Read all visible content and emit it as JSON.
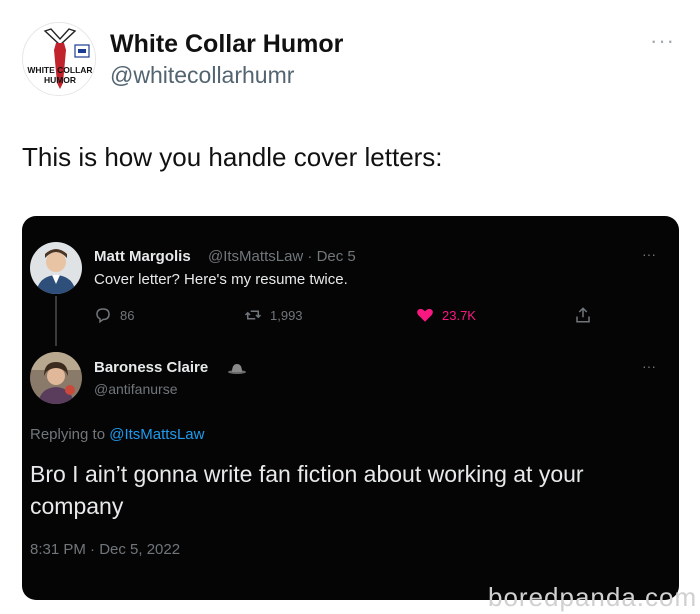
{
  "post": {
    "author_name": "White Collar Humor",
    "author_handle": "@whitecollarhumr",
    "more_label": "···",
    "avatar_text_line1": "WHITE COLLAR",
    "avatar_text_line2": "HUMOR",
    "text": "This is how you handle cover letters:"
  },
  "embedded": {
    "tweet1": {
      "name": "Matt Margolis",
      "meta": "@ItsMattsLaw · Dec 5",
      "text": "Cover letter? Here's my resume twice.",
      "replies": "86",
      "retweets": "1,993",
      "likes": "23.7K",
      "more_label": "···"
    },
    "tweet2": {
      "name": "Baroness Claire",
      "handle": "@antifanurse",
      "more_label": "···",
      "replying_prefix": "Replying to",
      "replying_handle": "@ItsMattsLaw",
      "text": "Bro I ain’t gonna write fan fiction about working at your company",
      "timestamp": "8:31 PM · Dec 5, 2022"
    }
  },
  "watermark": "boredpanda.com",
  "colors": {
    "like": "#f91880",
    "link": "#1d9bf0",
    "card_bg": "#050505"
  }
}
